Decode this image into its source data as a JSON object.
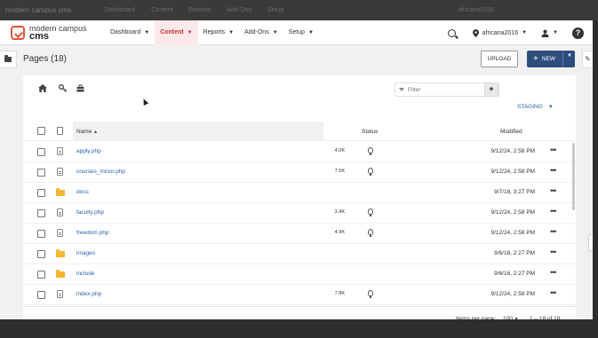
{
  "ghost_bar": {
    "logo": "modern campus cms",
    "items": [
      "Dashboard",
      "Content",
      "Reports",
      "Add-Ons",
      "Setup"
    ],
    "site": "africana2016"
  },
  "logo": {
    "line1": "modern campus",
    "line2": "cms"
  },
  "nav": [
    {
      "label": "Dashboard",
      "active": false
    },
    {
      "label": "Content",
      "active": true
    },
    {
      "label": "Reports",
      "active": false
    },
    {
      "label": "Add-Ons",
      "active": false
    },
    {
      "label": "Setup",
      "active": false
    }
  ],
  "site_name": "africana2016",
  "page_title": "Pages (18)",
  "buttons": {
    "upload": "UPLOAD",
    "new": "NEW"
  },
  "toolbar": {
    "filter_placeholder": "Filter",
    "staging": "STAGING"
  },
  "table": {
    "headers": {
      "name": "Name",
      "status": "Status",
      "modified": "Modified"
    },
    "rows": [
      {
        "type": "file",
        "name": "apply.php",
        "size": "4.0K",
        "status_icon": "lightbulb-icon",
        "modified": "9/12/24, 2:58 PM"
      },
      {
        "type": "file",
        "name": "courses_minor.php",
        "size": "7.5K",
        "status_icon": "lightbulb-icon",
        "modified": "9/12/24, 2:58 PM"
      },
      {
        "type": "folder",
        "name": "docs",
        "size": "",
        "status_icon": "",
        "modified": "9/7/16, 3:27 PM"
      },
      {
        "type": "file",
        "name": "faculty.php",
        "size": "3.4K",
        "status_icon": "lightbulb-icon",
        "modified": "9/12/24, 2:58 PM"
      },
      {
        "type": "file",
        "name": "freedom.php",
        "size": "4.9K",
        "status_icon": "lightbulb-icon",
        "modified": "9/12/24, 2:58 PM"
      },
      {
        "type": "folder",
        "name": "images",
        "size": "",
        "status_icon": "",
        "modified": "9/6/16, 2:27 PM"
      },
      {
        "type": "folder",
        "name": "include",
        "size": "",
        "status_icon": "",
        "modified": "9/6/16, 2:27 PM"
      },
      {
        "type": "file",
        "name": "index.php",
        "size": "7.8K",
        "status_icon": "lightbulb-icon",
        "modified": "9/12/24, 2:58 PM"
      }
    ]
  },
  "footer": {
    "items_per_page_label": "Items per page:",
    "items_per_page": "100",
    "range": "1 – 18 of 18"
  },
  "colors": {
    "accent": "#2e4d7f",
    "link": "#2f62a8",
    "active_nav_bg": "#fde9ea",
    "active_nav_text": "#c22e3c",
    "folder": "#f2b632",
    "logo": "#e2533a"
  }
}
